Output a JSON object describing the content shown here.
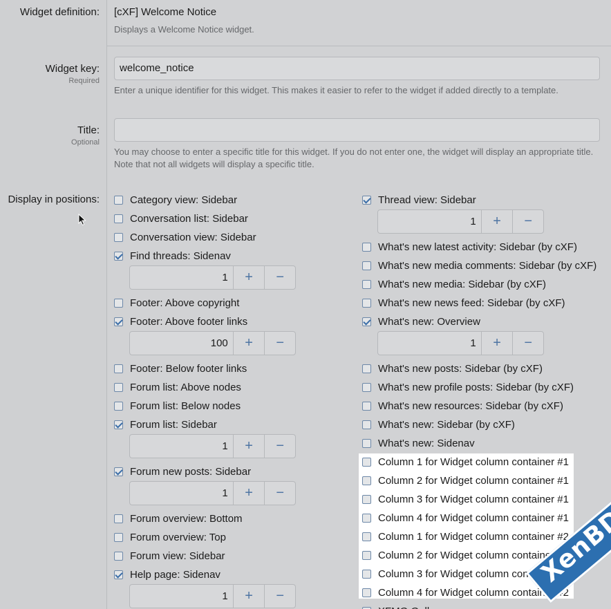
{
  "widget_definition": {
    "label": "Widget definition:",
    "value": "[cXF] Welcome Notice",
    "description": "Displays a Welcome Notice widget."
  },
  "widget_key": {
    "label": "Widget key:",
    "sublabel": "Required",
    "value": "welcome_notice",
    "hint": "Enter a unique identifier for this widget. This makes it easier to refer to the widget if added directly to a template."
  },
  "title_field": {
    "label": "Title:",
    "sublabel": "Optional",
    "value": "",
    "hint": "You may choose to enter a specific title for this widget. If you do not enter one, the widget will display an appropriate title. Note that not all widgets will display a specific title."
  },
  "positions": {
    "label": "Display in positions:",
    "left": [
      {
        "label": "Category view: Sidebar",
        "checked": false
      },
      {
        "label": "Conversation list: Sidebar",
        "checked": false
      },
      {
        "label": "Conversation view: Sidebar",
        "checked": false
      },
      {
        "label": "Find threads: Sidenav",
        "checked": true,
        "order": "1"
      },
      {
        "label": "Footer: Above copyright",
        "checked": false
      },
      {
        "label": "Footer: Above footer links",
        "checked": true,
        "order": "100"
      },
      {
        "label": "Footer: Below footer links",
        "checked": false
      },
      {
        "label": "Forum list: Above nodes",
        "checked": false
      },
      {
        "label": "Forum list: Below nodes",
        "checked": false
      },
      {
        "label": "Forum list: Sidebar",
        "checked": true,
        "order": "1"
      },
      {
        "label": "Forum new posts: Sidebar",
        "checked": true,
        "order": "1"
      },
      {
        "label": "Forum overview: Bottom",
        "checked": false
      },
      {
        "label": "Forum overview: Top",
        "checked": false
      },
      {
        "label": "Forum view: Sidebar",
        "checked": false
      },
      {
        "label": "Help page: Sidenav",
        "checked": true,
        "order": "1"
      }
    ],
    "right": [
      {
        "label": "Thread view: Sidebar",
        "checked": true,
        "order": "1"
      },
      {
        "label": "What's new latest activity: Sidebar (by cXF)",
        "checked": false
      },
      {
        "label": "What's new media comments: Sidebar (by cXF)",
        "checked": false
      },
      {
        "label": "What's new media: Sidebar (by cXF)",
        "checked": false
      },
      {
        "label": "What's new news feed: Sidebar (by cXF)",
        "checked": false
      },
      {
        "label": "What's new: Overview",
        "checked": true,
        "order": "1"
      },
      {
        "label": "What's new posts: Sidebar (by cXF)",
        "checked": false
      },
      {
        "label": "What's new profile posts: Sidebar (by cXF)",
        "checked": false
      },
      {
        "label": "What's new resources: Sidebar (by cXF)",
        "checked": false
      },
      {
        "label": "What's new: Sidebar (by cXF)",
        "checked": false
      },
      {
        "label": "What's new: Sidenav",
        "checked": false
      },
      {
        "label": "Column 1 for Widget column container #1",
        "checked": false
      },
      {
        "label": "Column 2 for Widget column container #1",
        "checked": false
      },
      {
        "label": "Column 3 for Widget column container #1",
        "checked": false
      },
      {
        "label": "Column 4 for Widget column container #1",
        "checked": false
      },
      {
        "label": "Column 1 for Widget column container #2",
        "checked": false
      },
      {
        "label": "Column 2 for Widget column container #2",
        "checked": false
      },
      {
        "label": "Column 3 for Widget column container #2",
        "checked": false
      },
      {
        "label": "Column 4 for Widget column container #2",
        "checked": false
      },
      {
        "label": "XFMG Gall",
        "checked": false
      }
    ]
  },
  "stepper": {
    "plus": "+",
    "minus": "−"
  },
  "watermark": {
    "text": "XenBD.Com"
  },
  "colors": {
    "accent": "#3b6ea8",
    "watermark": "#2c6fb0"
  }
}
